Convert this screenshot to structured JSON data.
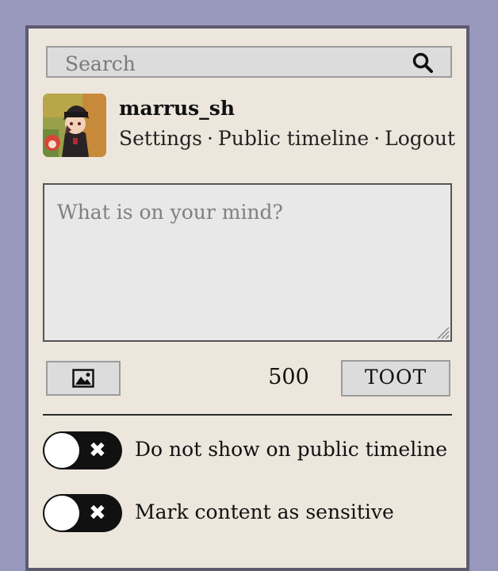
{
  "search": {
    "placeholder": "Search",
    "icon": "search-icon"
  },
  "profile": {
    "username": "marrus_sh",
    "links": [
      "Settings",
      "Public timeline",
      "Logout"
    ],
    "separator": "·"
  },
  "compose": {
    "placeholder": "What is on your mind?",
    "char_count": "500",
    "submit_label": "TOOT",
    "media_icon": "image-icon"
  },
  "options": {
    "unlisted_label": "Do not show on public timeline",
    "unlisted_enabled": false,
    "sensitive_label": "Mark content as sensitive",
    "sensitive_enabled": false
  },
  "colors": {
    "background": "#9898bd",
    "panel": "#ede6dc",
    "panel_border": "#5d5b70",
    "input": "#dcdcdc",
    "toggle": "#111111"
  }
}
